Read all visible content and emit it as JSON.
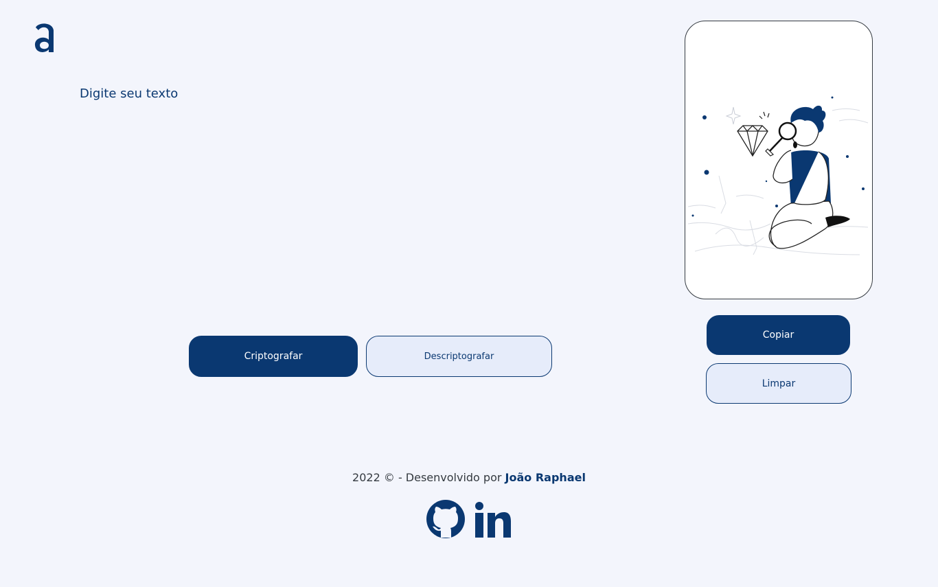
{
  "header": {
    "logo_icon": "alura-a-logo-icon"
  },
  "input": {
    "placeholder": "Digite seu texto",
    "value": ""
  },
  "actions": {
    "encrypt_label": "Criptografar",
    "decrypt_label": "Descriptografar"
  },
  "output": {
    "illustration_icon": "person-with-magnifying-glass-illustration",
    "copy_label": "Copiar",
    "clear_label": "Limpar"
  },
  "footer": {
    "prefix": "2022 © - Desenvolvido por ",
    "author": "João Raphael",
    "social": [
      {
        "name": "github-icon"
      },
      {
        "name": "linkedin-icon"
      }
    ]
  },
  "colors": {
    "background": "#F3F5FC",
    "primary": "#0A3871",
    "secondary_bg": "#E6ECFA",
    "text_dark": "#343A40"
  }
}
